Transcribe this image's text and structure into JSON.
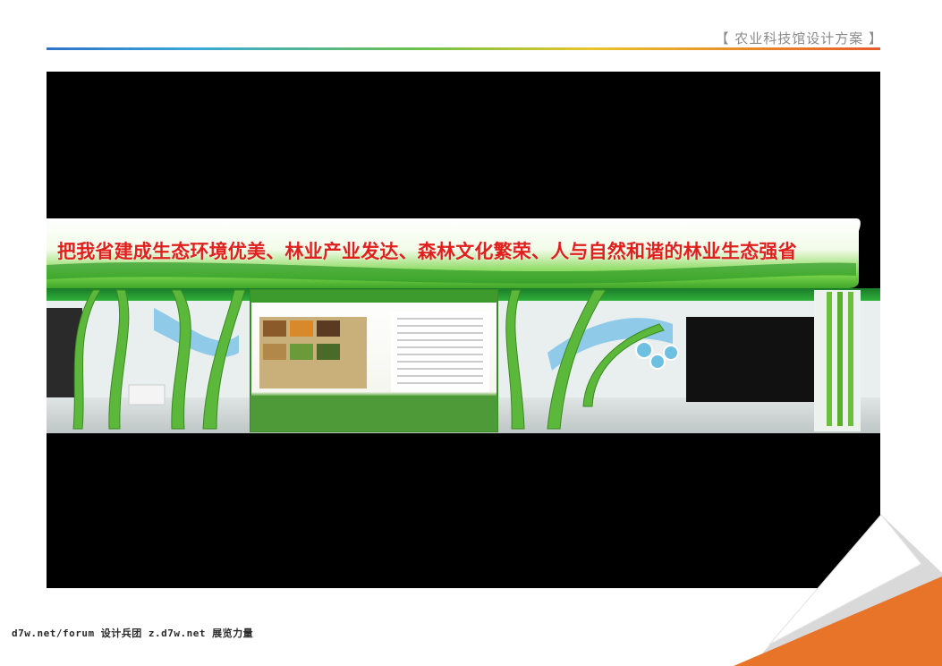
{
  "header": {
    "title": "【 农业科技馆设计方案 】"
  },
  "render": {
    "banner_slogan": "把我省建成生态环境优美、林业产业发达、森林文化繁荣、人与自然和谐的林业生态强省"
  },
  "footer": {
    "watermark": "d7w.net/forum 设计兵团 z.d7w.net 展览力量"
  },
  "colors": {
    "rule_start": "#2f72c8",
    "rule_end": "#e85a2a",
    "slogan": "#e0201c",
    "corner_orange": "#e8742a"
  }
}
